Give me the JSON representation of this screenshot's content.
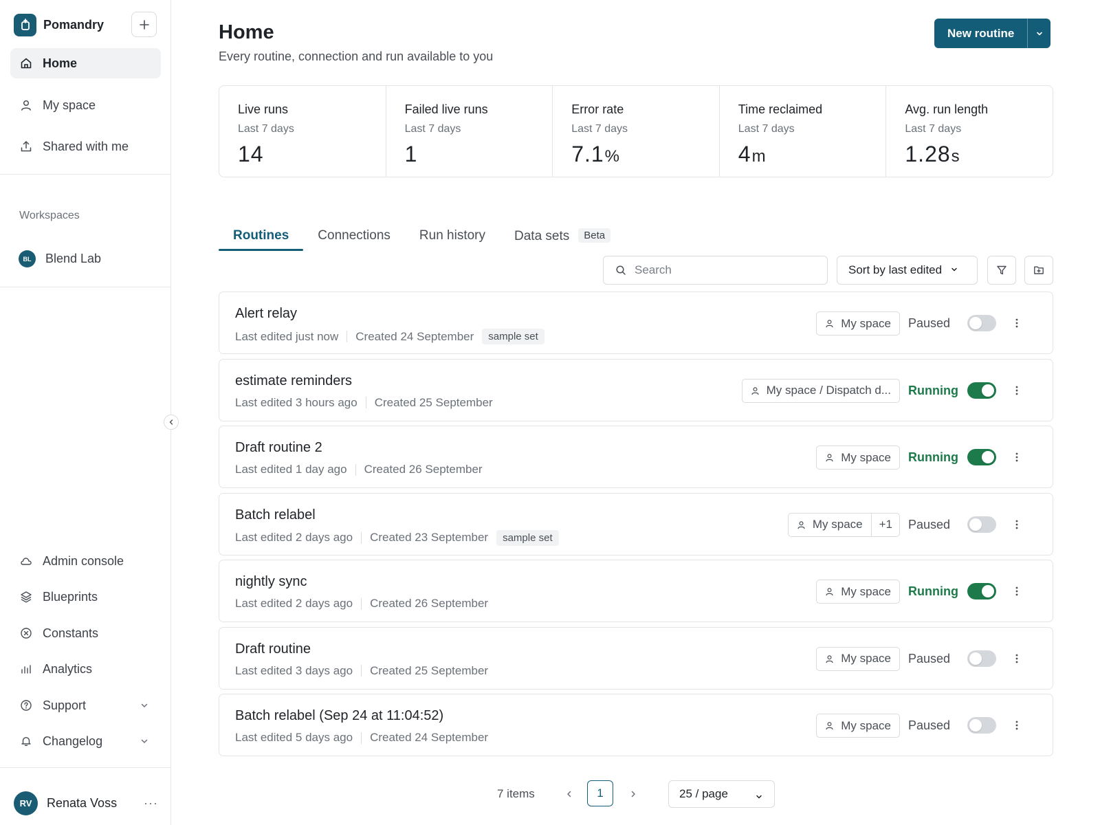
{
  "app": {
    "name": "Pomandry"
  },
  "sidebar": {
    "nav": [
      {
        "label": "Home",
        "icon": "home-icon",
        "active": true
      },
      {
        "label": "My space",
        "icon": "person-icon"
      },
      {
        "label": "Shared with me",
        "icon": "share-icon"
      }
    ],
    "workspaces_label": "Workspaces",
    "workspace": {
      "initials": "BL",
      "name": "Blend Lab"
    },
    "bottom_nav": [
      {
        "label": "Admin console",
        "icon": "cloud-icon"
      },
      {
        "label": "Blueprints",
        "icon": "layers-icon"
      },
      {
        "label": "Constants",
        "icon": "x-circle-icon"
      },
      {
        "label": "Analytics",
        "icon": "bar-chart-icon"
      },
      {
        "label": "Support",
        "icon": "help-circle-icon",
        "expandable": true
      },
      {
        "label": "Changelog",
        "icon": "bell-icon",
        "expandable": true
      }
    ],
    "user": {
      "initials": "RV",
      "name": "Renata Voss",
      "more": "···"
    }
  },
  "header": {
    "title": "Home",
    "subtitle": "Every routine, connection and run available to you",
    "new_button": "New routine"
  },
  "stats": [
    {
      "title": "Live runs",
      "period": "Last 7 days",
      "value": "14",
      "unit": ""
    },
    {
      "title": "Failed live runs",
      "period": "Last 7 days",
      "value": "1",
      "unit": ""
    },
    {
      "title": "Error rate",
      "period": "Last 7 days",
      "value": "7.1",
      "unit": "%"
    },
    {
      "title": "Time reclaimed",
      "period": "Last 7 days",
      "value": "4",
      "unit": "m"
    },
    {
      "title": "Avg. run length",
      "period": "Last 7 days",
      "value": "1.28",
      "unit": "s"
    }
  ],
  "tabs": [
    {
      "label": "Routines",
      "active": true
    },
    {
      "label": "Connections"
    },
    {
      "label": "Run history"
    },
    {
      "label": "Data sets",
      "badge": "Beta"
    }
  ],
  "toolbar": {
    "search_placeholder": "Search",
    "sort_label": "Sort by last edited"
  },
  "routines": [
    {
      "name": "Alert relay",
      "edited": "Last edited just now",
      "created": "Created 24 September",
      "tag": "sample set",
      "space": "My space",
      "extra": "",
      "status": "Paused",
      "running": false
    },
    {
      "name": "estimate reminders",
      "edited": "Last edited 3 hours ago",
      "created": "Created 25 September",
      "tag": "",
      "space": "My space / Dispatch d...",
      "extra": "",
      "status": "Running",
      "running": true
    },
    {
      "name": "Draft routine 2",
      "edited": "Last edited 1 day ago",
      "created": "Created 26 September",
      "tag": "",
      "space": "My space",
      "extra": "",
      "status": "Running",
      "running": true
    },
    {
      "name": "Batch relabel",
      "edited": "Last edited 2 days ago",
      "created": "Created 23 September",
      "tag": "sample set",
      "space": "My space",
      "extra": "+1",
      "status": "Paused",
      "running": false
    },
    {
      "name": "nightly sync",
      "edited": "Last edited 2 days ago",
      "created": "Created 26 September",
      "tag": "",
      "space": "My space",
      "extra": "",
      "status": "Running",
      "running": true
    },
    {
      "name": "Draft routine",
      "edited": "Last edited 3 days ago",
      "created": "Created 25 September",
      "tag": "",
      "space": "My space",
      "extra": "",
      "status": "Paused",
      "running": false
    },
    {
      "name": "Batch relabel (Sep 24 at 11:04:52)",
      "edited": "Last edited 5 days ago",
      "created": "Created 24 September",
      "tag": "",
      "space": "My space",
      "extra": "",
      "status": "Paused",
      "running": false
    }
  ],
  "pagination": {
    "count": "7 items",
    "page": "1",
    "page_size": "25 / page"
  },
  "colors": {
    "accent": "#135d78",
    "running": "#1d7a4a",
    "toggle_off": "#d4d7db"
  }
}
